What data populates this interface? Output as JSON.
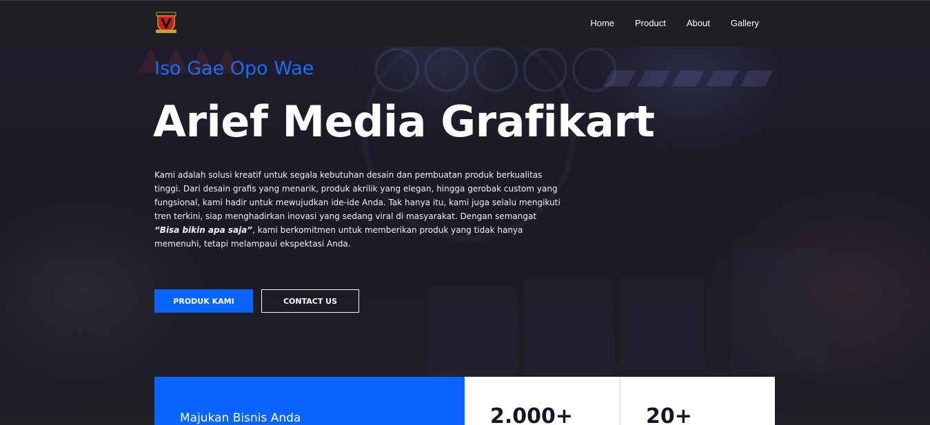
{
  "nav": {
    "logo_icon": "shield-crest-icon",
    "items": [
      {
        "label": "Home"
      },
      {
        "label": "Product"
      },
      {
        "label": "About"
      },
      {
        "label": "Gallery"
      }
    ]
  },
  "hero": {
    "eyebrow": "Iso Gae Opo Wae",
    "title": "Arief Media Grafikart",
    "description_part1": "Kami adalah solusi kreatif untuk segala kebutuhan desain dan pembuatan produk berkualitas tinggi. Dari desain grafis yang menarik, produk akrilik yang elegan, hingga gerobak custom yang fungsional, kami hadir untuk mewujudkan ide-ide Anda. Tak hanya itu, kami juga selalu mengikuti tren terkini, siap menghadirkan inovasi yang sedang viral di masyarakat. Dengan semangat ",
    "description_emphasis": "“Bisa bikin apa saja”",
    "description_part2": ", kami berkomitmen untuk memberikan produk yang tidak hanya memenuhi, tetapi melampaui ekspektasi Anda.",
    "primary_button": "PRODUK KAMI",
    "secondary_button": "CONTACT US"
  },
  "stats": {
    "tagline": "Majukan Bisnis Anda",
    "items": [
      {
        "value": "2.000+"
      },
      {
        "value": "20+"
      }
    ]
  },
  "colors": {
    "accent": "#0a64ff",
    "eyebrow": "#1c6cf5",
    "nav_bg": "#1f1e25",
    "hero_bg": "#1b1a26"
  }
}
